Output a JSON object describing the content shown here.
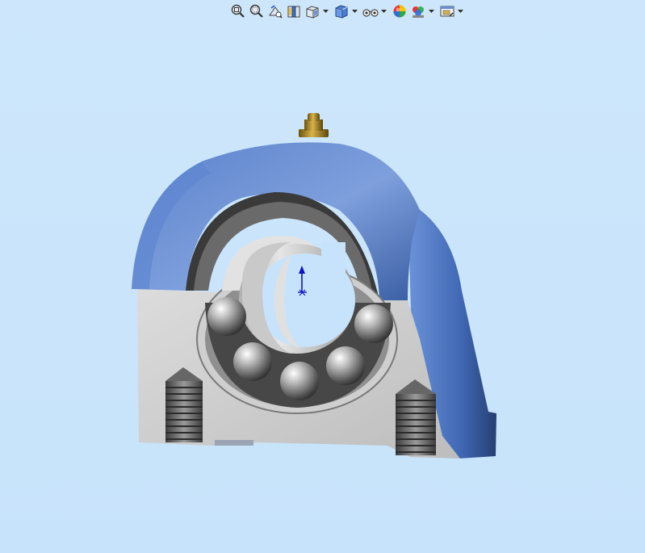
{
  "toolbar": {
    "buttons": [
      {
        "name": "zoom-to-fit-icon",
        "has_menu": false
      },
      {
        "name": "zoom-to-area-icon",
        "has_menu": false
      },
      {
        "name": "previous-view-icon",
        "has_menu": false
      },
      {
        "name": "section-view-icon",
        "has_menu": false
      },
      {
        "name": "view-orientation-icon",
        "has_menu": true
      },
      {
        "name": "display-style-icon",
        "has_menu": true
      },
      {
        "name": "hide-show-items-icon",
        "has_menu": true
      },
      {
        "name": "edit-appearance-icon",
        "has_menu": false
      },
      {
        "name": "apply-scene-icon",
        "has_menu": true
      },
      {
        "name": "view-settings-icon",
        "has_menu": true
      }
    ]
  },
  "scene": {
    "background_color": "#cbe5fb",
    "housing_color": "#4a72c0",
    "base_color": "#d3d3d3",
    "fitting_color": "#b08a2a",
    "triad_color": "#1010cc",
    "model": "pillow-block-bearing-section-view"
  }
}
